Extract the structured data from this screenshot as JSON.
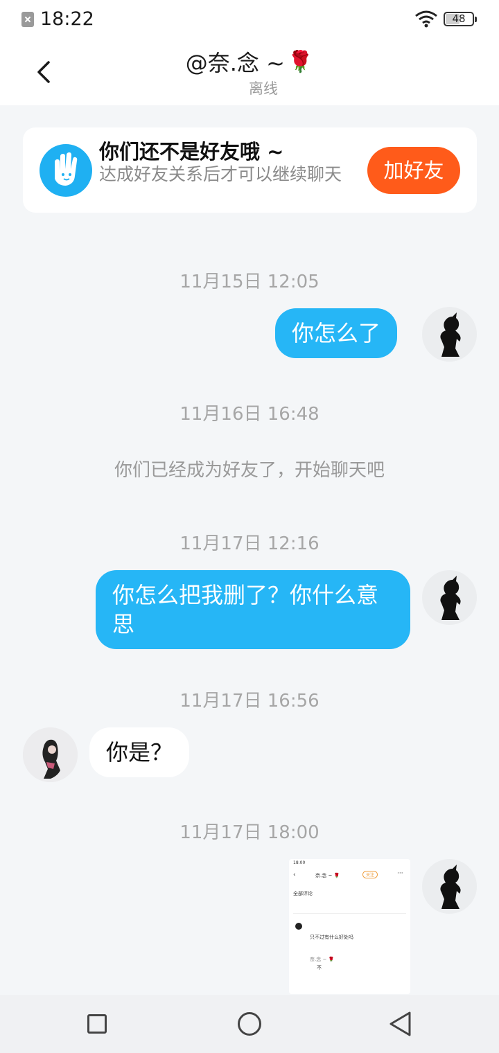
{
  "status_bar": {
    "time": "18:22",
    "battery": "48"
  },
  "header": {
    "title": "@奈.念 ~",
    "title_emoji": "🌹",
    "status": "离线"
  },
  "friend_card": {
    "title": "你们还不是好友哦 ~",
    "description": "达成好友关系后才可以继续聊天",
    "button": "加好友"
  },
  "messages": [
    {
      "time": "11月15日 12:05",
      "text": "你怎么了",
      "direction": "out"
    },
    {
      "time": "11月16日 16:48",
      "system": "你们已经成为好友了，开始聊天吧"
    },
    {
      "time": "11月17日 12:16",
      "text": "你怎么把我删了？你什么意思",
      "direction": "out"
    },
    {
      "time": "11月17日 16:56",
      "text": "你是？",
      "direction": "in"
    },
    {
      "time": "11月17日 18:00",
      "image": "screenshot",
      "direction": "out"
    }
  ],
  "thumbnail": {
    "header": "奈.念 ~ 🌹",
    "follow": "关注",
    "section": "全部评论",
    "comment1": "只不过有什么好处吗",
    "reply1": "奈.念 ~ 🌹",
    "reply1_text": "不"
  },
  "colors": {
    "bubble_out": "#26b6f6",
    "accent": "#ff5b1a",
    "background": "#f4f6f8"
  }
}
